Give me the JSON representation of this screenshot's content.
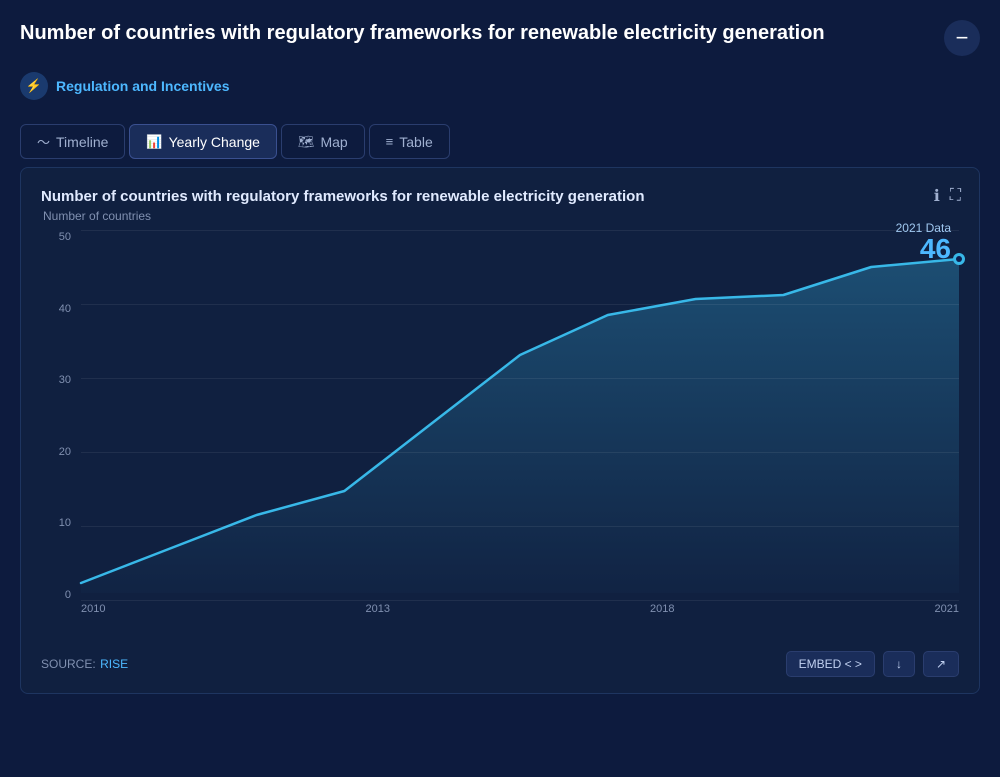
{
  "header": {
    "title": "Number of countries with regulatory frameworks for renewable electricity generation",
    "minus_button_label": "−"
  },
  "tag": {
    "icon": "⚡",
    "label": "Regulation and Incentives"
  },
  "tabs": [
    {
      "id": "timeline",
      "label": "Timeline",
      "icon": "timeline",
      "active": false
    },
    {
      "id": "yearly-change",
      "label": "Yearly Change",
      "icon": "bar",
      "active": true
    },
    {
      "id": "map",
      "label": "Map",
      "icon": "map",
      "active": false
    },
    {
      "id": "table",
      "label": "Table",
      "icon": "table",
      "active": false
    }
  ],
  "chart": {
    "title": "Number of countries with regulatory frameworks for renewable electricity generation",
    "y_axis_label": "Number of countries",
    "y_ticks": [
      0,
      10,
      20,
      30,
      40,
      50
    ],
    "x_ticks": [
      "2010",
      "2013",
      "2018",
      "2021"
    ],
    "data_label_year": "2021 Data",
    "data_label_value": "46",
    "data_points": [
      {
        "year": 2010,
        "value": 1
      },
      {
        "year": 2011,
        "value": 4
      },
      {
        "year": 2012,
        "value": 7
      },
      {
        "year": 2013,
        "value": 9
      },
      {
        "year": 2014,
        "value": 17
      },
      {
        "year": 2015,
        "value": 24
      },
      {
        "year": 2016,
        "value": 32
      },
      {
        "year": 2017,
        "value": 36
      },
      {
        "year": 2018,
        "value": 39
      },
      {
        "year": 2019,
        "value": 40
      },
      {
        "year": 2020,
        "value": 44
      },
      {
        "year": 2021,
        "value": 46
      }
    ]
  },
  "footer": {
    "source_label": "SOURCE:",
    "source_link_text": "RISE",
    "embed_button": "EMBED < >",
    "download_icon": "↓",
    "share_icon": "↗"
  }
}
